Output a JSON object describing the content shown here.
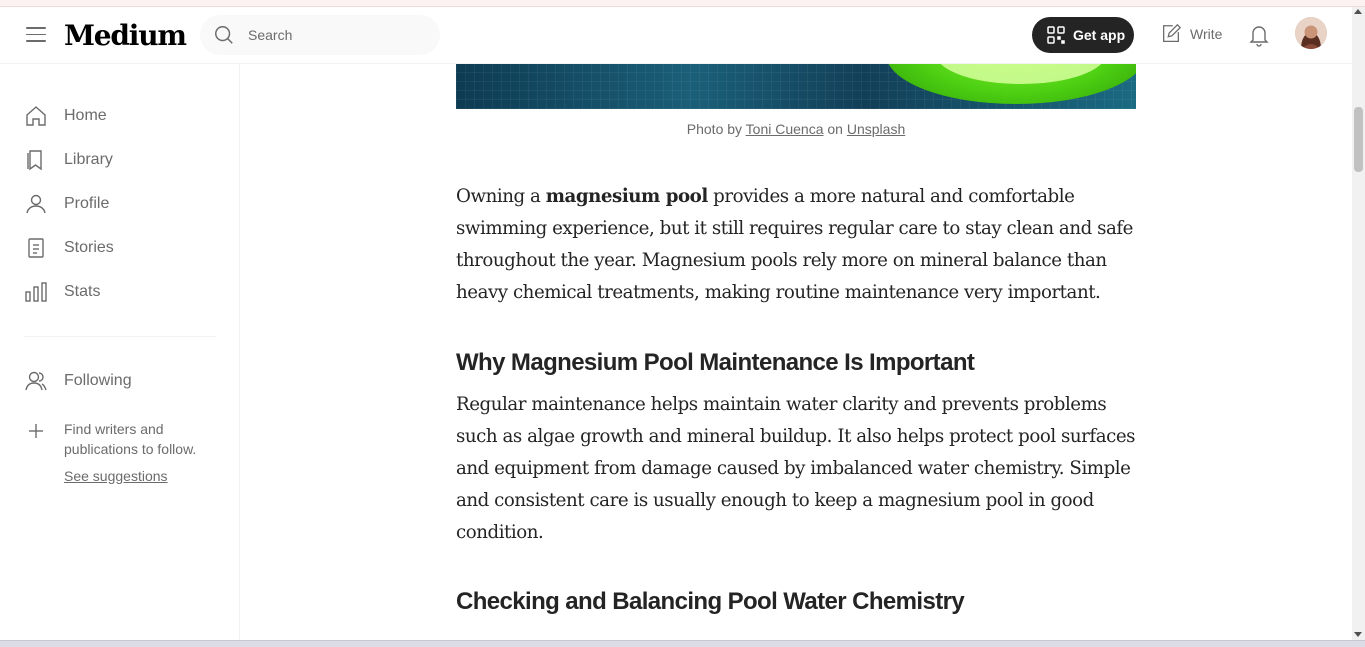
{
  "header": {
    "logo": "Medium",
    "search_placeholder": "Search",
    "get_app_label": "Get app",
    "write_label": "Write"
  },
  "sidebar": {
    "items": [
      {
        "label": "Home",
        "icon": "home-icon"
      },
      {
        "label": "Library",
        "icon": "bookmark-icon"
      },
      {
        "label": "Profile",
        "icon": "user-icon"
      },
      {
        "label": "Stories",
        "icon": "document-icon"
      },
      {
        "label": "Stats",
        "icon": "chart-icon"
      }
    ],
    "following_label": "Following",
    "find_text": "Find writers and publications to follow.",
    "see_suggestions": "See suggestions"
  },
  "article": {
    "caption": {
      "prefix": "Photo by",
      "author": "Toni Cuenca",
      "mid": "on",
      "source": "Unsplash"
    },
    "p1": {
      "before": "Owning a",
      "bold": "magnesium pool",
      "after": "provides a more natural and comfortable swimming experience, but it still requires regular care to stay clean and safe throughout the year. Magnesium pools rely more on mineral balance than heavy chemical treatments, making routine maintenance very important."
    },
    "h2_1": "Why Magnesium Pool Maintenance Is Important",
    "p2": "Regular maintenance helps maintain water clarity and prevents problems such as algae growth and mineral buildup. It also helps protect pool surfaces and equipment from damage caused by imbalanced water chemistry. Simple and consistent care is usually enough to keep a magnesium pool in good condition.",
    "h2_2": "Checking and Balancing Pool Water Chemistry"
  },
  "colors": {
    "text": "#242424",
    "muted": "#6b6b6b",
    "get_app_bg": "#242424"
  }
}
